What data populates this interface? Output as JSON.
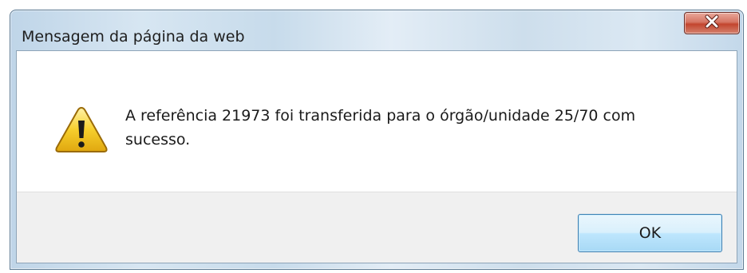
{
  "dialog": {
    "title": "Mensagem da página da web",
    "close_icon": "close-icon",
    "message_icon": "warning-icon",
    "message": "A referência 21973 foi transferida para o órgão/unidade 25/70 com sucesso.",
    "ok_label": "OK"
  },
  "colors": {
    "frame": "#c7dbeb",
    "close_button": "#c3452e",
    "button_bar": "#f0f0f0",
    "ok_button": "#bee6fd",
    "warning_fill": "#f4c21c"
  }
}
